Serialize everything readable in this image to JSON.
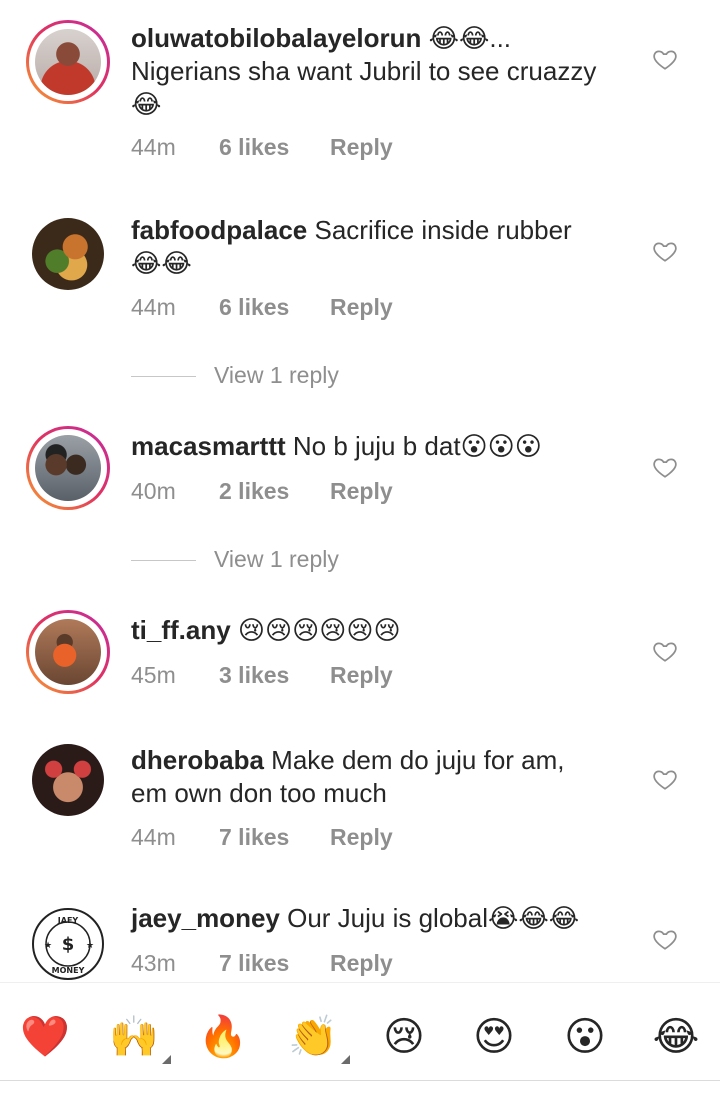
{
  "comments": [
    {
      "username": "oluwatobilobalayelorun",
      "text_parts": [
        "😂😂...",
        "Nigerians sha want Jubril to see cruazzy😂"
      ],
      "time": "44m",
      "likes": "6 likes",
      "reply": "Reply"
    },
    {
      "username": "fabfoodpalace",
      "text_parts": [
        "Sacrifice inside rubber 😂😂"
      ],
      "time": "44m",
      "likes": "6 likes",
      "reply": "Reply",
      "view_replies": "View 1 reply"
    },
    {
      "username": "macasmarttt",
      "text_parts": [
        "No b juju b dat😮😮😮"
      ],
      "time": "40m",
      "likes": "2 likes",
      "reply": "Reply",
      "view_replies": "View 1 reply"
    },
    {
      "username": "ti_ff.any",
      "text_parts": [
        "😢😢😢😢😢😢"
      ],
      "time": "45m",
      "likes": "3 likes",
      "reply": "Reply"
    },
    {
      "username": "dherobaba",
      "text_parts": [
        "Make dem do juju for am, em own don too much"
      ],
      "time": "44m",
      "likes": "7 likes",
      "reply": "Reply"
    },
    {
      "username": "jaey_money",
      "text_parts": [
        "Our Juju is global😭😂😂"
      ],
      "time": "43m",
      "likes": "7 likes",
      "reply": "Reply",
      "avatar_text": [
        "JAEY",
        "$",
        "MONEY"
      ]
    }
  ],
  "reactions": [
    {
      "emoji": "❤️",
      "icon": "heart-emoji"
    },
    {
      "emoji": "🙌",
      "icon": "raised-hands-emoji"
    },
    {
      "emoji": "🔥",
      "icon": "fire-emoji"
    },
    {
      "emoji": "👏",
      "icon": "clapping-hands-emoji"
    },
    {
      "emoji": "😢",
      "icon": "crying-face-emoji"
    },
    {
      "emoji": "😍",
      "icon": "heart-eyes-emoji"
    },
    {
      "emoji": "😮",
      "icon": "surprised-face-emoji"
    },
    {
      "emoji": "😂",
      "icon": "tears-of-joy-emoji"
    }
  ],
  "colors": {
    "text": "#262626",
    "meta": "#8e8e8e",
    "story_ring_start": "#f9a12e",
    "story_ring_end": "#c32aa3",
    "background": "#ffffff"
  }
}
